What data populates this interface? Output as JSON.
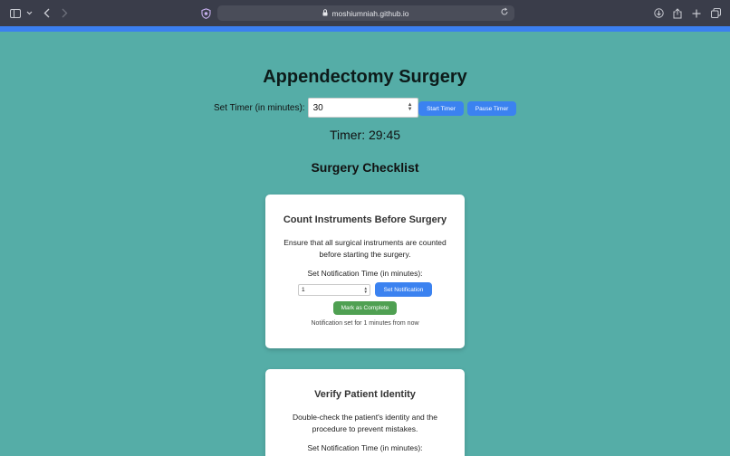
{
  "browser": {
    "url": "moshiumniah.github.io",
    "icons": [
      "sidebar-icon",
      "chevron-down-icon",
      "back-icon",
      "forward-icon",
      "shield-icon",
      "lock-icon",
      "reload-icon",
      "download-icon",
      "share-icon",
      "new-tab-icon",
      "tabs-icon"
    ],
    "accent_color": "#3b7ff0"
  },
  "page": {
    "title": "Appendectomy Surgery",
    "timer": {
      "label": "Set Timer (in minutes):",
      "value": "30",
      "start_label": "Start Timer",
      "pause_label": "Pause Timer",
      "display": "Timer: 29:45"
    },
    "checklist_title": "Surgery Checklist",
    "checklist": [
      {
        "title": "Count Instruments Before Surgery",
        "description": "Ensure that all surgical instruments are counted before starting the surgery.",
        "notify_label": "Set Notification Time (in minutes):",
        "notify_value": "1",
        "set_notification_label": "Set Notification",
        "complete_label": "Mark as Complete",
        "status": "Notification set for 1 minutes from now"
      },
      {
        "title": "Verify Patient Identity",
        "description": "Double-check the patient's identity and the procedure to prevent mistakes.",
        "notify_label": "Set Notification Time (in minutes):"
      }
    ]
  },
  "colors": {
    "background": "#55ada7",
    "button_blue": "#3b82f0",
    "button_green": "#4fa052"
  }
}
